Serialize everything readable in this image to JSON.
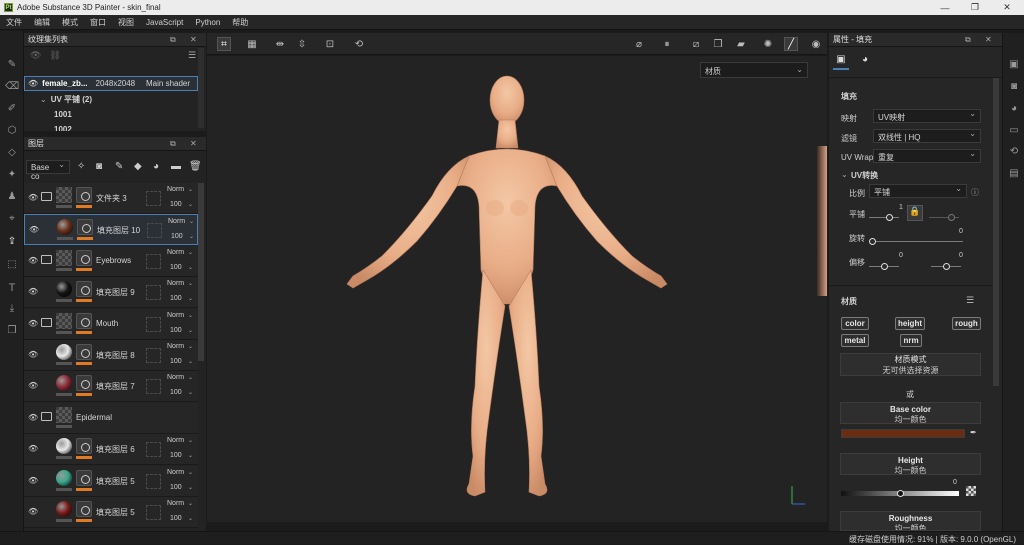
{
  "window": {
    "title": "Adobe Substance 3D Painter - skin_final",
    "logo_text": "Pt"
  },
  "menu": [
    "文件",
    "编辑",
    "模式",
    "窗口",
    "视图",
    "JavaScript",
    "Python",
    "帮助"
  ],
  "texture_set": {
    "title": "纹理集列表",
    "item_name": "female_zb...",
    "item_size": "2048x2048",
    "item_shader": "Main shader",
    "uv_label": "UV 平铺 (2)",
    "tiles": [
      "1001",
      "1002"
    ]
  },
  "layers": {
    "title": "图层",
    "channel": "Base co",
    "items": [
      {
        "name": "文件夹 3",
        "type": "folder",
        "blend": "Norm",
        "opacity": "100",
        "thumb": "#3a3a3a"
      },
      {
        "name": "填充图层 10",
        "type": "fill",
        "blend": "Norm",
        "opacity": "100",
        "thumb": "#6b3018",
        "selected": true
      },
      {
        "name": "Eyebrows",
        "type": "folder",
        "blend": "Norm",
        "opacity": "100",
        "thumb": "#3a3a3a"
      },
      {
        "name": "填充图层 9",
        "type": "fill",
        "blend": "Norm",
        "opacity": "100",
        "thumb": "#141414"
      },
      {
        "name": "Mouth",
        "type": "folder",
        "blend": "Norm",
        "opacity": "100",
        "thumb": "#3a3a3a"
      },
      {
        "name": "填充图层 8",
        "type": "fill",
        "blend": "Norm",
        "opacity": "100",
        "thumb": "#e8e8e8"
      },
      {
        "name": "填充图层 7",
        "type": "fill",
        "blend": "Norm",
        "opacity": "100",
        "thumb": "#8c2a36"
      },
      {
        "name": "Epidermal",
        "type": "folder",
        "blend": "",
        "opacity": "",
        "thumb": "#3a3a3a"
      },
      {
        "name": "填充图层 6",
        "type": "fill",
        "blend": "Norm",
        "opacity": "100",
        "thumb": "#e8e8e8"
      },
      {
        "name": "填充图层 5",
        "type": "fill",
        "blend": "Norm",
        "opacity": "100",
        "thumb": "#3aa88c"
      },
      {
        "name": "填充图层 5",
        "type": "fill",
        "blend": "Norm",
        "opacity": "100",
        "thumb": "#7a1a1a"
      }
    ]
  },
  "viewport": {
    "material_dropdown": "材质"
  },
  "properties": {
    "title": "属性 - 填充",
    "section_fill": "填充",
    "mapping_label": "映射",
    "mapping_value": "UV映射",
    "filter_label": "滤镜",
    "filter_value": "双线性 | HQ",
    "wrap_label": "UV Wrap",
    "wrap_value": "重复",
    "uv_transform": "UV转换",
    "scale_label": "比例",
    "scale_value": "平铺",
    "tile_label": "平铺",
    "tile_value": "1",
    "rotate_label": "旋转",
    "rotate_value": "0",
    "offset_label": "偏移",
    "offset_x": "0",
    "offset_y": "0",
    "material_section": "材质",
    "chips": [
      "color",
      "height",
      "rough",
      "metal",
      "nrm"
    ],
    "material_mode": "材质模式",
    "no_resource": "无可供选择资源",
    "or": "或",
    "base_color_label": "Base color",
    "base_color_sub": "均一颜色",
    "base_color_hex": "#6b2c14",
    "height_label": "Height",
    "height_sub": "均一颜色",
    "height_value": "0",
    "roughness_label": "Roughness",
    "roughness_sub": "均一颜色"
  },
  "status": {
    "text": "缓存磁盘使用情况:  91% | 版本: 9.0.0 (OpenGL)"
  },
  "colors": {
    "accent": "#e07b24",
    "selection": "#4a7fb5"
  }
}
